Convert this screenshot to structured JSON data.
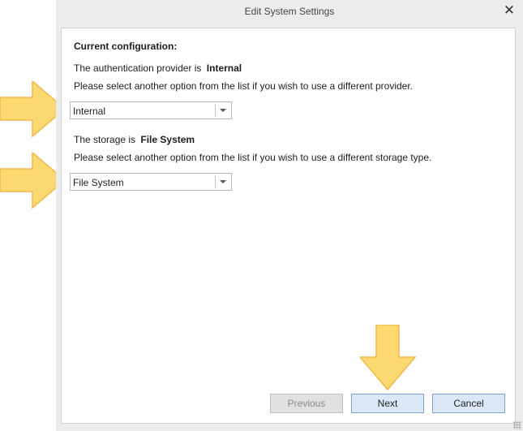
{
  "dialog": {
    "title": "Edit System Settings",
    "close_symbol": "✕"
  },
  "config": {
    "heading": "Current configuration:",
    "auth_prefix": "The authentication provider is",
    "auth_value": "Internal",
    "auth_hint": "Please select another option from the list if you wish to use a different provider.",
    "auth_selected": "Internal",
    "storage_prefix": "The storage is",
    "storage_value": "File System",
    "storage_hint": "Please select another option from the list if you wish to use a different storage type.",
    "storage_selected": "File System"
  },
  "buttons": {
    "previous": "Previous",
    "next": "Next",
    "cancel": "Cancel"
  },
  "colors": {
    "callout_fill": "#fbd970",
    "callout_stroke": "#f0b84a",
    "button_primary_bg": "#dbe8f7",
    "button_primary_border": "#7da2ce"
  }
}
